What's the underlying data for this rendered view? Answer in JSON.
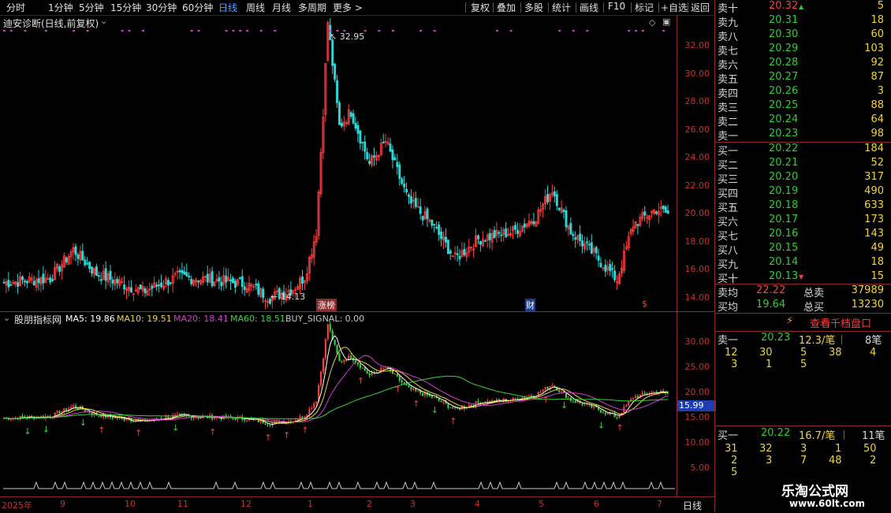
{
  "toolbar": {
    "periods": [
      "分时",
      "1分钟",
      "5分钟",
      "15分钟",
      "30分钟",
      "60分钟",
      "日线",
      "周线",
      "月线",
      "多周期",
      "更多 >"
    ],
    "active_period": "日线",
    "buttons": [
      "复权",
      "叠加",
      "多股",
      "统计",
      "画线",
      "F10",
      "标记",
      "+自选",
      "返回"
    ]
  },
  "price_pane": {
    "title": "迪安诊断(日线,前复权)",
    "hi_label": "32.95",
    "lo_label": "14.13",
    "events": [
      "涨榜",
      "财",
      "$"
    ],
    "axis_ticks": [
      "32.00",
      "30.00",
      "28.00",
      "26.00",
      "24.00",
      "22.00",
      "20.00",
      "18.00",
      "16.00",
      "14.00"
    ]
  },
  "indicator_pane": {
    "title": "股朋指标网",
    "ma5": "MA5: 19.86",
    "ma10": "MA10: 19.51",
    "ma20": "MA20: 18.41",
    "ma60": "MA60: 18.51",
    "buy_signal": "BUY_SIGNAL: 0.00",
    "axis_ticks": [
      "30.00",
      "25.00",
      "20.00",
      "15.00",
      "10.00",
      "5.00"
    ],
    "price_marker": "15.99"
  },
  "bottom_axis": {
    "months": [
      "2025年",
      "9",
      "10",
      "11",
      "12",
      "1",
      "2",
      "3",
      "4",
      "5",
      "6",
      "7"
    ],
    "period": "日线"
  },
  "order_book": {
    "asks": [
      {
        "label": "卖十",
        "price": "20.32",
        "qty": "5"
      },
      {
        "label": "卖九",
        "price": "20.31",
        "qty": "18"
      },
      {
        "label": "卖八",
        "price": "20.30",
        "qty": "60"
      },
      {
        "label": "卖七",
        "price": "20.29",
        "qty": "103"
      },
      {
        "label": "卖六",
        "price": "20.28",
        "qty": "92"
      },
      {
        "label": "卖五",
        "price": "20.27",
        "qty": "87"
      },
      {
        "label": "卖四",
        "price": "20.26",
        "qty": "3"
      },
      {
        "label": "卖三",
        "price": "20.25",
        "qty": "88"
      },
      {
        "label": "卖二",
        "price": "20.24",
        "qty": "64"
      },
      {
        "label": "卖一",
        "price": "20.23",
        "qty": "98"
      }
    ],
    "bids": [
      {
        "label": "买一",
        "price": "20.22",
        "qty": "184"
      },
      {
        "label": "买二",
        "price": "20.21",
        "qty": "52"
      },
      {
        "label": "买三",
        "price": "20.20",
        "qty": "317"
      },
      {
        "label": "买四",
        "price": "20.19",
        "qty": "490"
      },
      {
        "label": "买五",
        "price": "20.18",
        "qty": "633"
      },
      {
        "label": "买六",
        "price": "20.17",
        "qty": "173"
      },
      {
        "label": "买七",
        "price": "20.16",
        "qty": "143"
      },
      {
        "label": "买八",
        "price": "20.15",
        "qty": "49"
      },
      {
        "label": "买九",
        "price": "20.14",
        "qty": "18"
      },
      {
        "label": "买十",
        "price": "20.13",
        "qty": "15"
      }
    ],
    "avg_sell_label": "卖均",
    "avg_sell": "22.22",
    "total_sell_label": "总卖",
    "total_sell": "37989",
    "avg_buy_label": "买均",
    "avg_buy": "19.64",
    "total_buy_label": "总买",
    "total_buy": "13230",
    "depth_link": "查看千档盘口"
  },
  "queue_sell": {
    "label": "卖一",
    "price": "20.23",
    "per_trade": "12.3/笔",
    "count": "8笔",
    "row1": [
      "12",
      "30",
      "5",
      "38",
      "4"
    ],
    "row2": [
      "3",
      "1",
      "5"
    ]
  },
  "queue_buy": {
    "label": "买一",
    "price": "20.22",
    "per_trade": "16.7/笔",
    "count": "11笔",
    "row1": [
      "31",
      "32",
      "3",
      "1",
      "50"
    ],
    "row2": [
      "2",
      "3",
      "7",
      "48",
      "2"
    ],
    "row3": [
      "5"
    ]
  },
  "watermark": {
    "line1": "乐淘公式网",
    "line2": "www.60lt.com"
  },
  "colors": {
    "up": "#ff3c3c",
    "down": "#28d8d8",
    "ma5": "#ffffff",
    "ma10": "#f0d23c",
    "ma20": "#d23cd2",
    "ma60": "#3cd23c"
  }
}
